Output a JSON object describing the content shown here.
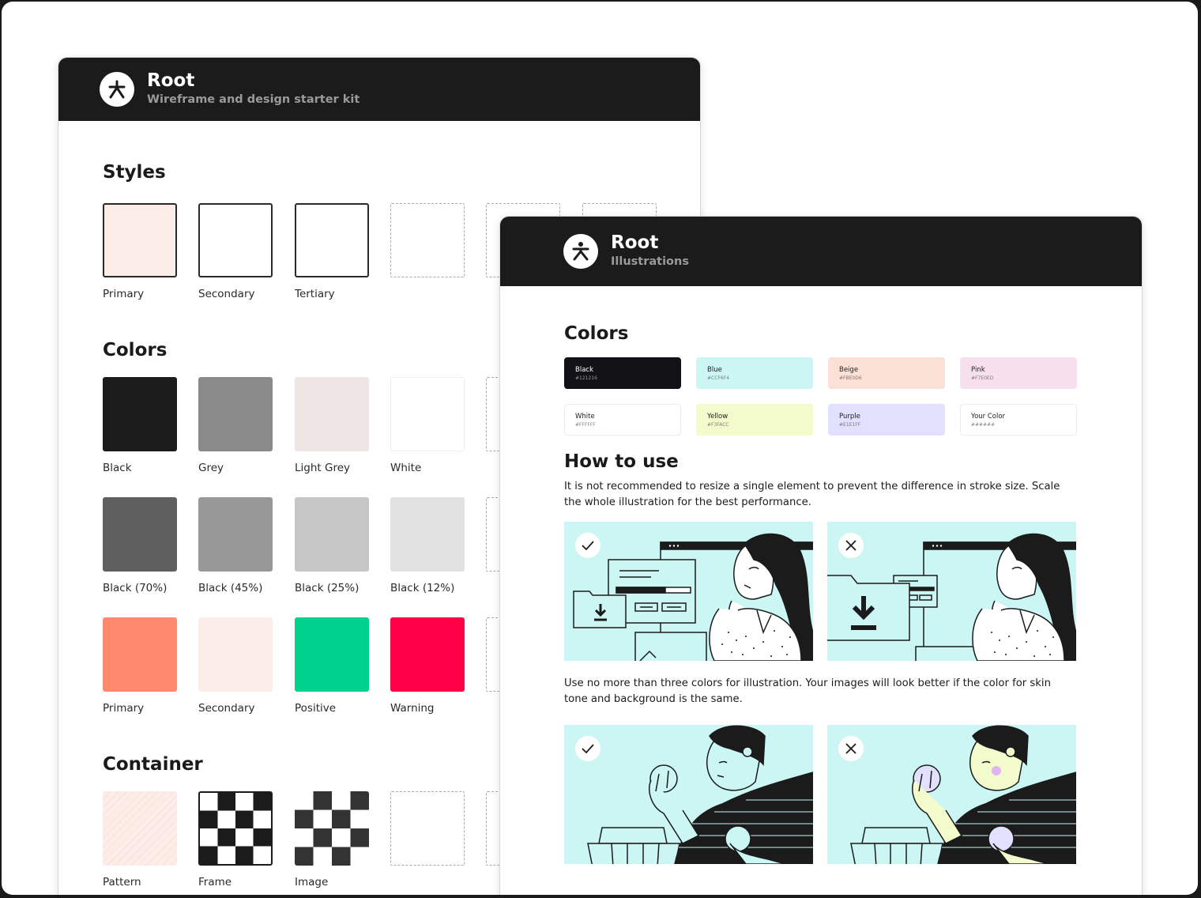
{
  "back_card": {
    "title": "Root",
    "subtitle": "Wireframe and design starter kit",
    "styles": {
      "heading": "Styles",
      "items": [
        {
          "label": "Primary",
          "fill": "#FDEDE8"
        },
        {
          "label": "Secondary",
          "fill": "#FFFFFF"
        },
        {
          "label": "Tertiary",
          "fill": "#FFFFFF"
        }
      ]
    },
    "colors": {
      "heading": "Colors",
      "row1": [
        {
          "label": "Black",
          "fill": "#1B1B1B"
        },
        {
          "label": "Grey",
          "fill": "#8A8A8A"
        },
        {
          "label": "Light Grey",
          "fill": "#EDE5E3"
        },
        {
          "label": "White",
          "fill": "#FFFFFF"
        }
      ],
      "row2": [
        {
          "label": "Black (70%)",
          "fill": "#5F5F5F"
        },
        {
          "label": "Black (45%)",
          "fill": "#989898"
        },
        {
          "label": "Black (25%)",
          "fill": "#C6C6C6"
        },
        {
          "label": "Black (12%)",
          "fill": "#E2E2E2"
        }
      ],
      "row3": [
        {
          "label": "Primary",
          "fill": "#FF8A6E"
        },
        {
          "label": "Secondary",
          "fill": "#FDEDE8"
        },
        {
          "label": "Positive",
          "fill": "#00D28E"
        },
        {
          "label": "Warning",
          "fill": "#FF0046"
        }
      ]
    },
    "container": {
      "heading": "Container",
      "items": [
        {
          "label": "Pattern"
        },
        {
          "label": "Frame"
        },
        {
          "label": "Image"
        }
      ]
    }
  },
  "front_card": {
    "title": "Root",
    "subtitle": "Illustrations",
    "colors_heading": "Colors",
    "palette": [
      {
        "name": "Black",
        "hex": "#121216",
        "fill": "#121216",
        "text": "#FFFFFF"
      },
      {
        "name": "Blue",
        "hex": "#CCF6F4",
        "fill": "#CCF6F4",
        "text": "#222222"
      },
      {
        "name": "Beige",
        "hex": "#FBE0D6",
        "fill": "#FBE0D6",
        "text": "#222222"
      },
      {
        "name": "Pink",
        "hex": "#F7E0ED",
        "fill": "#F7E0ED",
        "text": "#222222"
      },
      {
        "name": "White",
        "hex": "#FFFFFF",
        "fill": "#FFFFFF",
        "text": "#222222"
      },
      {
        "name": "Yellow",
        "hex": "#F3FACC",
        "fill": "#F3FACC",
        "text": "#222222"
      },
      {
        "name": "Purple",
        "hex": "#E1E1FF",
        "fill": "#E1E1FF",
        "text": "#222222"
      },
      {
        "name": "Your Color",
        "hex": "######",
        "fill": "#FFFFFF",
        "text": "#222222"
      }
    ],
    "how_heading": "How to use",
    "para1": "It is not recommended to resize a single element to prevent the difference in stroke size. Scale the whole illustration for the best performance.",
    "para2": "Use no more than three colors for illustration. Your images will look better if the color for skin tone and background is the same.",
    "illustration_bg": "#CCF6F4"
  }
}
